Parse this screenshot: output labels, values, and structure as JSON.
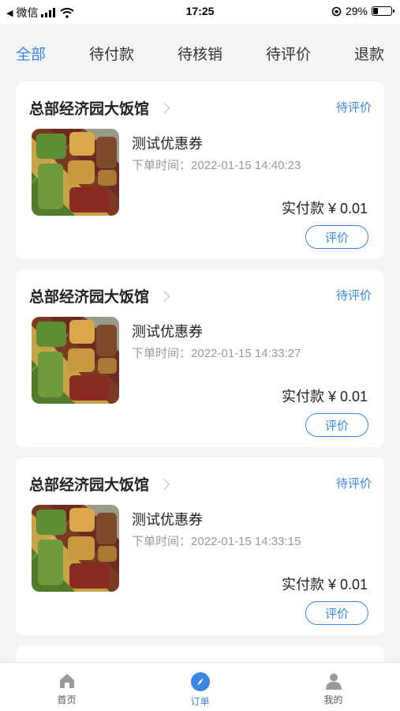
{
  "status_bar": {
    "back_app": "微信",
    "time": "17:25",
    "battery": "29%",
    "battery_level": 0.29
  },
  "tabs": [
    {
      "label": "全部",
      "active": true
    },
    {
      "label": "待付款",
      "active": false
    },
    {
      "label": "待核销",
      "active": false
    },
    {
      "label": "待评价",
      "active": false
    },
    {
      "label": "退款",
      "active": false
    }
  ],
  "orders": [
    {
      "shop": "总部经济园大饭馆",
      "status": "待评价",
      "product": "测试优惠券",
      "order_time_label": "下单时间：",
      "order_time": "2022-01-15 14:40:23",
      "paid": "实付款 ¥ 0.01",
      "action": "评价"
    },
    {
      "shop": "总部经济园大饭馆",
      "status": "待评价",
      "product": "测试优惠券",
      "order_time_label": "下单时间：",
      "order_time": "2022-01-15 14:33:27",
      "paid": "实付款 ¥ 0.01",
      "action": "评价"
    },
    {
      "shop": "总部经济园大饭馆",
      "status": "待评价",
      "product": "测试优惠券",
      "order_time_label": "下单时间：",
      "order_time": "2022-01-15 14:33:15",
      "paid": "实付款 ¥ 0.01",
      "action": "评价"
    }
  ],
  "bottom_nav": [
    {
      "label": "首页",
      "icon": "home-icon",
      "active": false
    },
    {
      "label": "订单",
      "icon": "compass-icon",
      "active": true
    },
    {
      "label": "我的",
      "icon": "user-icon",
      "active": false
    }
  ],
  "colors": {
    "accent": "#3a86e0"
  }
}
